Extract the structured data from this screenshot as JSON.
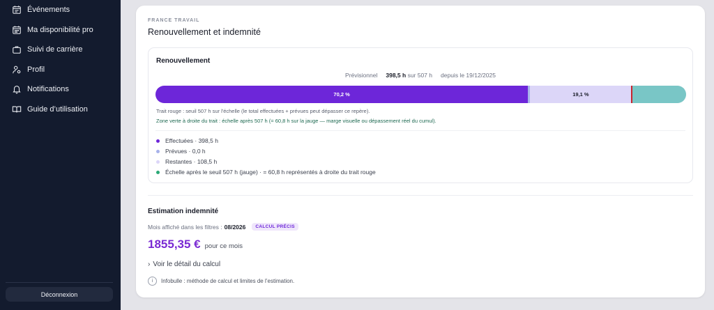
{
  "sidebar": {
    "items": [
      {
        "label": "Événements",
        "icon": "calendar-list-icon"
      },
      {
        "label": "Ma disponibilité pro",
        "icon": "calendar-icon"
      },
      {
        "label": "Suivi de carrière",
        "icon": "briefcase-icon"
      },
      {
        "label": "Profil",
        "icon": "user-gear-icon"
      },
      {
        "label": "Notifications",
        "icon": "bell-icon"
      },
      {
        "label": "Guide d’utilisation",
        "icon": "book-icon"
      }
    ],
    "logout_label": "Déconnexion"
  },
  "card": {
    "section_label": "FRANCE TRAVAIL",
    "title": "Renouvellement et indemnité"
  },
  "renewal": {
    "title": "Renouvellement",
    "summary": {
      "label": "Prévisionnel",
      "hours": "398,5 h",
      "of": "sur 507 h",
      "since": "depuis le 19/12/2025"
    },
    "gauge": {
      "done_fraction": 0.702,
      "planned_fraction": 0.004,
      "remaining_fraction": 0.191,
      "threshold_fraction": 0.897,
      "done_label": "70,2 %",
      "remaining_label": "19,1 %"
    },
    "note_threshold": "Trait rouge : seuil 507 h sur l'échelle (le total effectuées + prévues peut dépasser ce repère).",
    "note_green_zone": "Zone verte à droite du trait : échelle après 507 h (= 60,8 h sur la jauge — marge visuelle ou dépassement réel du cumul).",
    "legend": [
      {
        "label": "Effectuées · 398,5 h",
        "color": "#6d26d9"
      },
      {
        "label": "Prévues · 0,0 h",
        "color": "#a7b2ea"
      },
      {
        "label": "Restantes · 108,5 h",
        "color": "#dcd6f8"
      },
      {
        "label": "Échelle après le seuil 507 h (jauge) · = 60,8 h représentés à droite du trait rouge",
        "color": "#2aa876"
      }
    ]
  },
  "estimation": {
    "title": "Estimation indemnité",
    "month_label": "Mois affiché dans les filtres :",
    "month_value": "08/2026",
    "badge": "CALCUL PRÉCIS",
    "amount": "1855,35 €",
    "amount_suffix": "pour ce mois",
    "detail_chevron": "›",
    "detail_toggle": "Voir le détail du calcul",
    "info_icon_glyph": "i",
    "info_text": "Infobulle : méthode de calcul et limites de l’estimation."
  },
  "colors": {
    "accent": "#6d26d9",
    "threshold": "#c8252c",
    "over_zone": "#79c6c6",
    "sidebar_bg": "#131b2e"
  }
}
